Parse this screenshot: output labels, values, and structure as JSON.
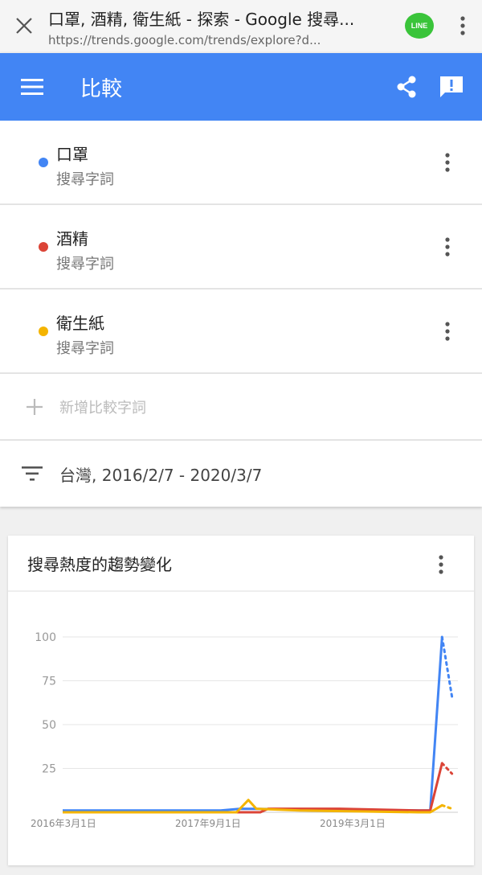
{
  "browser": {
    "title": "口罩, 酒精, 衛生紙 - 探索 - Google 搜尋...",
    "url": "https://trends.google.com/trends/explore?d...",
    "line_label": "LINE"
  },
  "app_bar": {
    "title": "比較"
  },
  "terms": [
    {
      "name": "口罩",
      "type": "搜尋字詞",
      "color": "#4285f4"
    },
    {
      "name": "酒精",
      "type": "搜尋字詞",
      "color": "#db4437"
    },
    {
      "name": "衛生紙",
      "type": "搜尋字詞",
      "color": "#f4b400"
    }
  ],
  "add_term": {
    "label": "新增比較字詞"
  },
  "filter": {
    "label": "台灣, 2016/2/7 - 2020/3/7"
  },
  "chart_card": {
    "title": "搜尋熱度的趨勢變化"
  },
  "chart_data": {
    "type": "line",
    "ylim": [
      0,
      100
    ],
    "yticks": [
      100,
      75,
      50,
      25
    ],
    "xticks": [
      "2016年3月1日",
      "2017年9月1日",
      "2019年3月1日"
    ],
    "grid": true,
    "series": [
      {
        "name": "口罩",
        "color": "#4285f4",
        "points": [
          [
            0.0,
            1
          ],
          [
            0.4,
            1
          ],
          [
            0.45,
            2
          ],
          [
            0.9,
            1
          ],
          [
            0.93,
            1
          ],
          [
            0.96,
            100
          ]
        ],
        "partial": [
          [
            0.96,
            100
          ],
          [
            0.985,
            66
          ]
        ]
      },
      {
        "name": "酒精",
        "color": "#db4437",
        "points": [
          [
            0.0,
            0
          ],
          [
            0.5,
            0
          ],
          [
            0.52,
            2
          ],
          [
            0.7,
            2
          ],
          [
            0.9,
            1
          ],
          [
            0.93,
            1
          ],
          [
            0.96,
            28
          ]
        ],
        "partial": [
          [
            0.96,
            28
          ],
          [
            0.985,
            22
          ]
        ]
      },
      {
        "name": "衛生紙",
        "color": "#f4b400",
        "points": [
          [
            0.0,
            0
          ],
          [
            0.44,
            0
          ],
          [
            0.47,
            7
          ],
          [
            0.49,
            2
          ],
          [
            0.6,
            1
          ],
          [
            0.9,
            0
          ],
          [
            0.93,
            0
          ],
          [
            0.96,
            4
          ]
        ],
        "partial": [
          [
            0.96,
            4
          ],
          [
            0.985,
            2
          ]
        ]
      }
    ]
  }
}
